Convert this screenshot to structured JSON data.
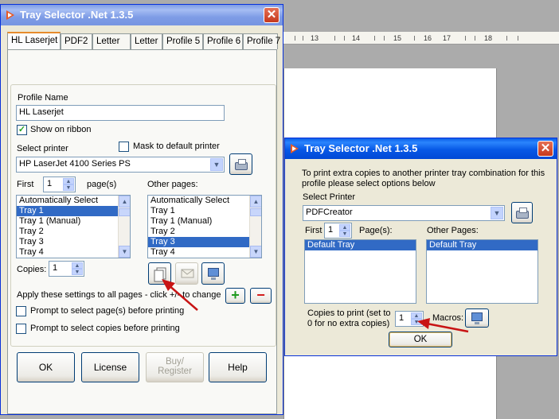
{
  "background": {
    "ruler_numbers": [
      "13",
      "14",
      "15",
      "16",
      "17",
      "18"
    ]
  },
  "main_window": {
    "title": "Tray Selector .Net 1.3.5",
    "tabs": [
      "HL Laserjet",
      "PDF2",
      "Letter",
      "Letter",
      "Profile 5",
      "Profile 6",
      "Profile 7"
    ],
    "profile_name_label": "Profile Name",
    "profile_name_value": "HL Laserjet",
    "show_on_ribbon_label": "Show on ribbon",
    "show_on_ribbon_checked": true,
    "select_printer_label": "Select printer",
    "mask_default_label": "Mask to default printer",
    "mask_default_checked": false,
    "printer_value": "HP LaserJet 4100 Series PS",
    "first_label": "First",
    "first_value": "1",
    "pages_label": "page(s)",
    "other_pages_label": "Other pages:",
    "first_trays": [
      "Automatically Select",
      "Tray 1",
      "Tray 1 (Manual)",
      "Tray 2",
      "Tray 3",
      "Tray 4"
    ],
    "first_selected": "Tray 1",
    "other_trays": [
      "Automatically Select",
      "Tray 1",
      "Tray 1 (Manual)",
      "Tray 2",
      "Tray 3",
      "Tray 4"
    ],
    "other_selected": "Tray 3",
    "copies_label": "Copies:",
    "copies_value": "1",
    "apply_label": "Apply these settings to all pages - click +/- to change",
    "add_symbol": "+",
    "remove_symbol": "−",
    "prompt_pages_label": "Prompt to select page(s) before printing",
    "prompt_copies_label": "Prompt to select copies before printing",
    "buttons": {
      "ok": "OK",
      "license": "License",
      "buy_line1": "Buy/",
      "buy_line2": "Register",
      "help": "Help"
    }
  },
  "copies_dialog": {
    "title": "Tray Selector .Net 1.3.5",
    "description_line1": "To print extra copies to another printer tray combination for this",
    "description_line2": "profile please select options below",
    "select_printer_label": "Select Printer",
    "printer_value": "PDFCreator",
    "first_label": "First",
    "first_value": "1",
    "pages_label": "Page(s):",
    "other_pages_label": "Other Pages:",
    "first_trays": [
      "Default Tray"
    ],
    "other_trays": [
      "Default Tray"
    ],
    "copies_line1": "Copies to print (set to",
    "copies_line2": "0 for no extra copies)",
    "copies_value": "1",
    "macros_label": "Macros:",
    "ok_label": "OK"
  },
  "colors": {
    "titlebar": "#0a5ee8",
    "selection": "#316ac5",
    "arrow": "#c81414",
    "add": "#1f9a1f",
    "remove": "#d21b1b"
  }
}
